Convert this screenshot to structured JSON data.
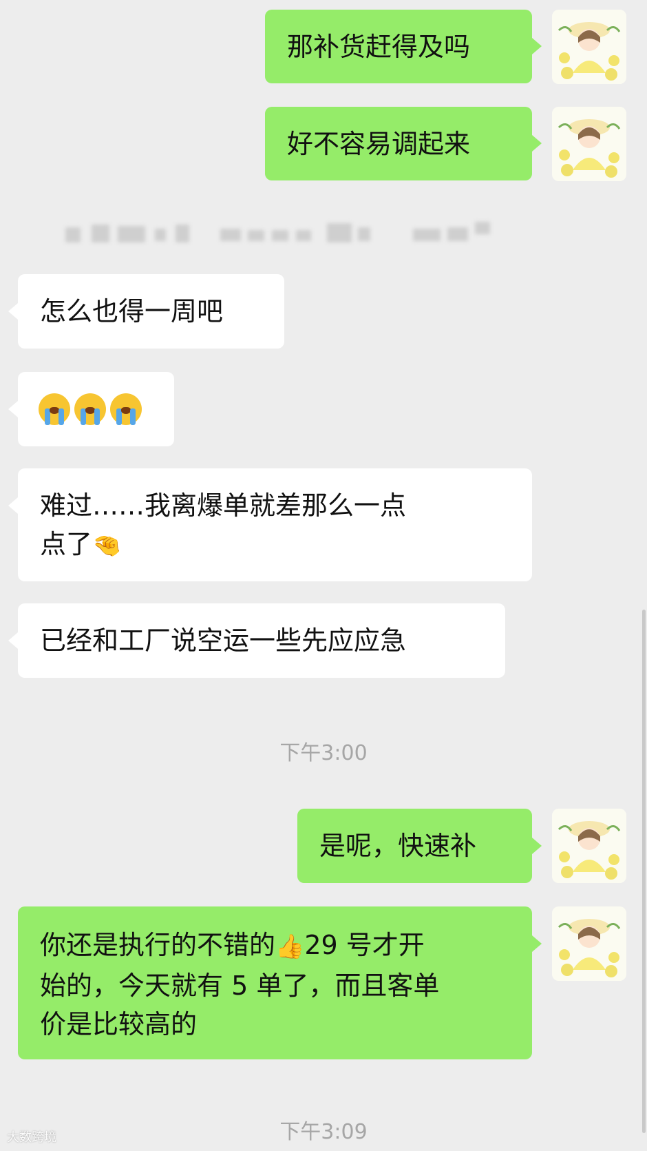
{
  "messages": [
    {
      "id": "m1",
      "side": "me",
      "text": "那补货赶得及吗"
    },
    {
      "id": "m2",
      "side": "me",
      "text": "好不容易调起来"
    },
    {
      "id": "m3",
      "side": "other",
      "text": "怎么也得一周吧"
    },
    {
      "id": "m4",
      "side": "other",
      "text": "😭😭😭"
    },
    {
      "id": "m5",
      "side": "other",
      "line1": "难过……我离爆单就差那么一点",
      "line2": "点了",
      "emoji": "🤏"
    },
    {
      "id": "m6",
      "side": "other",
      "text": "已经和工厂说空运一些先应应急"
    },
    {
      "id": "m7",
      "side": "me",
      "text": "是呢，快速补"
    },
    {
      "id": "m8",
      "side": "me",
      "line1_a": "你还是执行的不错的",
      "emoji": "👍",
      "line1_b": "29 号才开",
      "line2": "始的，今天就有 5 单了，而且客单",
      "line3": "价是比较高的"
    }
  ],
  "timestamps": {
    "t1": "下午3:00",
    "t2": "下午3:09"
  },
  "watermark": "大数跨境",
  "colors": {
    "background": "#ededed",
    "my_bubble": "#95ec69",
    "other_bubble": "#ffffff",
    "timestamp": "#a6a6a6"
  },
  "icons": {
    "avatar": "girl-with-flowers-avatar-icon",
    "cry_emoji": "loudly-crying-face-icon",
    "pinch_emoji": "pinching-hand-icon",
    "thumbs_emoji": "thumbs-up-icon"
  }
}
